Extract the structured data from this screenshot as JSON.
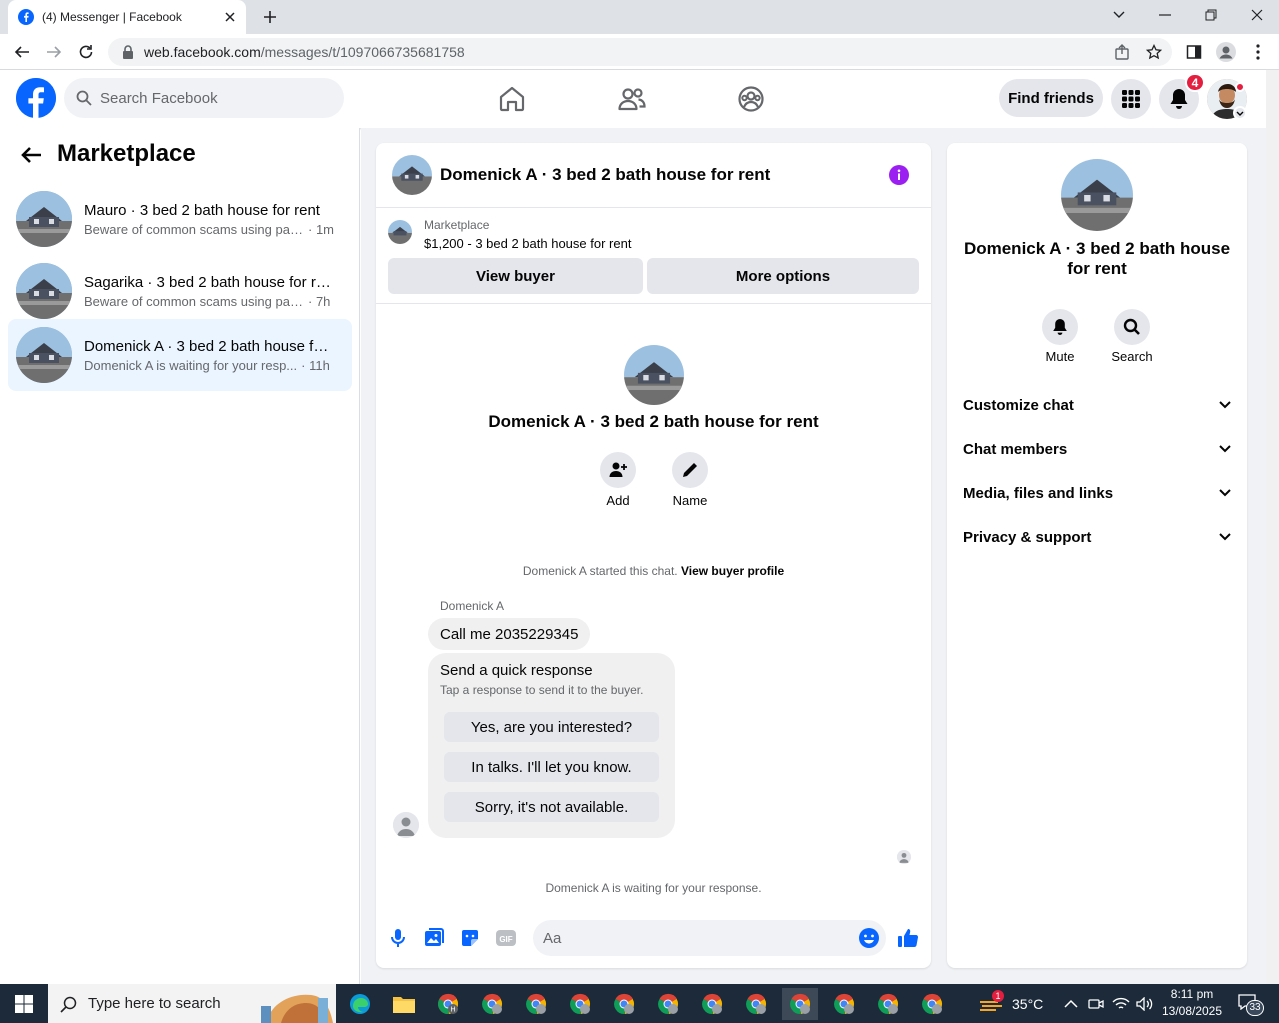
{
  "browser": {
    "tab_title": "(4) Messenger | Facebook",
    "url_host": "web.facebook.com",
    "url_path": "/messages/t/1097066735681758"
  },
  "header": {
    "search_placeholder": "Search Facebook",
    "find_friends": "Find friends",
    "notifications_count": "4",
    "brand_color": "#0866ff"
  },
  "sidebar": {
    "title": "Marketplace",
    "conversations": [
      {
        "name": "Mauro · 3 bed 2 bath house for rent",
        "message": "Beware of common scams using pay...",
        "time": "· 1m"
      },
      {
        "name": "Sagarika · 3 bed 2 bath house for rent",
        "message": "Beware of common scams using pay...",
        "time": "· 7h"
      },
      {
        "name": "Domenick A · 3 bed 2 bath house for rent",
        "message": "Domenick A is waiting for your resp...",
        "time": "· 11h"
      }
    ]
  },
  "chat": {
    "title": "Domenick A · 3 bed 2 bath house for rent",
    "listing_source": "Marketplace",
    "listing_title": "$1,200 - 3 bed 2 bath house for rent",
    "view_buyer": "View buyer",
    "more_options": "More options",
    "actions": {
      "add": "Add",
      "name": "Name"
    },
    "started_text": "Domenick A started this chat.",
    "view_buyer_profile": "View buyer profile",
    "sender": "Domenick A",
    "message": "Call me 2035229345",
    "quick_title": "Send a quick response",
    "quick_subtitle": "Tap a response to send it to the buyer.",
    "quick_options": [
      "Yes, are you interested?",
      "In talks. I'll let you know.",
      "Sorry, it's not available."
    ],
    "waiting_text": "Domenick A is waiting for your response.",
    "composer_placeholder": "Aa"
  },
  "details": {
    "title": "Domenick A · 3 bed 2 bath house for rent",
    "mute": "Mute",
    "search": "Search",
    "sections": [
      "Customize chat",
      "Chat members",
      "Media, files and links",
      "Privacy & support"
    ]
  },
  "taskbar": {
    "search_text": "Type here to search",
    "temperature": "35°C",
    "weather_badge": "1",
    "time": "8:11 pm",
    "date": "13/08/2025",
    "notifications": "33"
  }
}
